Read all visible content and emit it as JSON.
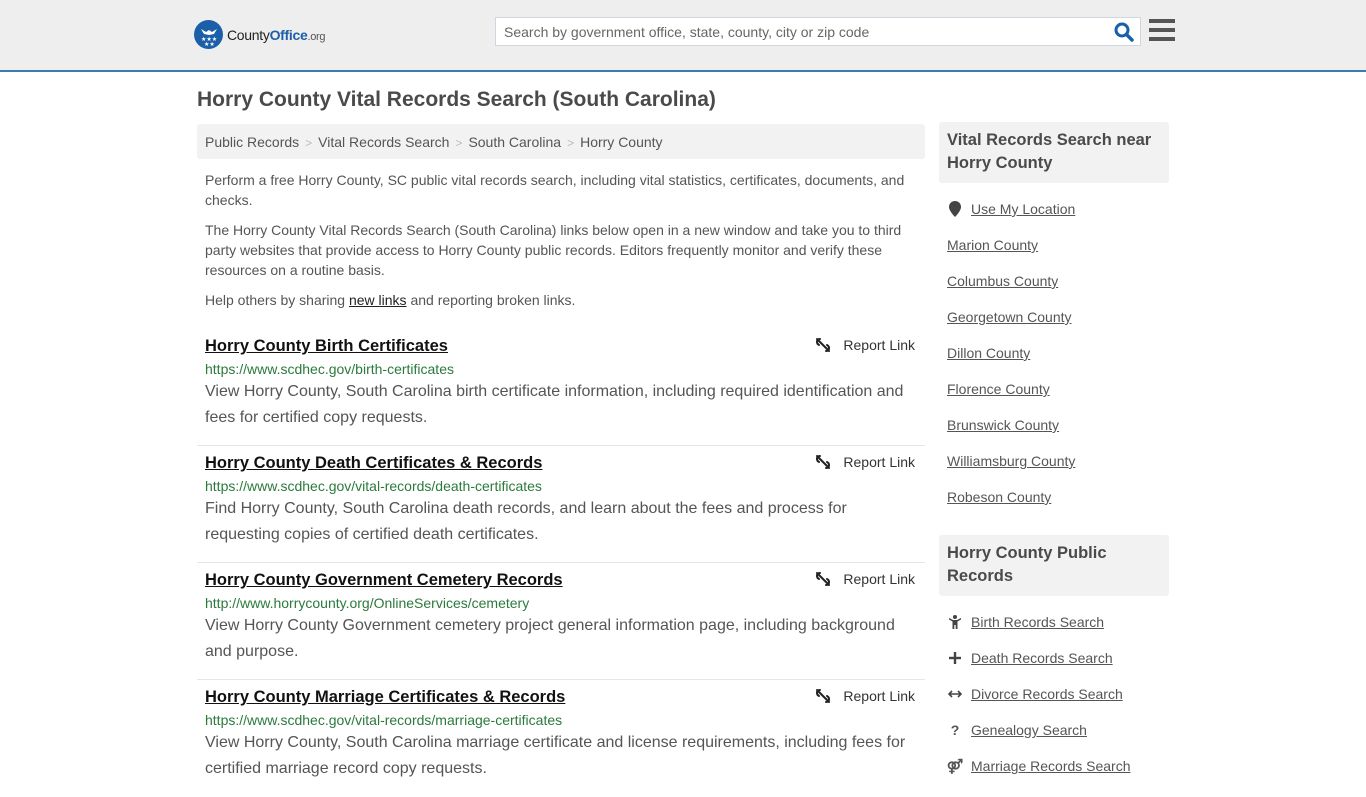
{
  "header": {
    "logo_county": "County",
    "logo_office": "Office",
    "logo_org": ".org",
    "search_placeholder": "Search by government office, state, county, city or zip code",
    "search_value": "",
    "brand_color": "#1b5fa8",
    "accent_border_color": "#3a7cb0"
  },
  "page": {
    "title": "Horry County Vital Records Search (South Carolina)"
  },
  "breadcrumb": [
    "Public Records",
    "Vital Records Search",
    "South Carolina",
    "Horry County"
  ],
  "intro": {
    "p1": "Perform a free Horry County, SC public vital records search, including vital statistics, certificates, documents, and checks.",
    "p2": "The Horry County Vital Records Search (South Carolina) links below open in a new window and take you to third party websites that provide access to Horry County public records. Editors frequently monitor and verify these resources on a routine basis.",
    "p3_before": "Help others by sharing ",
    "p3_link": "new links",
    "p3_after": " and reporting broken links."
  },
  "results": [
    {
      "title": "Horry County Birth Certificates",
      "url": "https://www.scdhec.gov/birth-certificates",
      "description": "View Horry County, South Carolina birth certificate information, including required identification and fees for certified copy requests.",
      "report_label": "Report Link"
    },
    {
      "title": "Horry County Death Certificates & Records",
      "url": "https://www.scdhec.gov/vital-records/death-certificates",
      "description": "Find Horry County, South Carolina death records, and learn about the fees and process for requesting copies of certified death certificates.",
      "report_label": "Report Link"
    },
    {
      "title": "Horry County Government Cemetery Records",
      "url": "http://www.horrycounty.org/OnlineServices/cemetery",
      "description": "View Horry County Government cemetery project general information page, including background and purpose.",
      "report_label": "Report Link"
    },
    {
      "title": "Horry County Marriage Certificates & Records",
      "url": "https://www.scdhec.gov/vital-records/marriage-certificates",
      "description": "View Horry County, South Carolina marriage certificate and license requirements, including fees for certified marriage record copy requests.",
      "report_label": "Report Link"
    }
  ],
  "sidebar": {
    "nearby_title": "Vital Records Search near Horry County",
    "use_location": "Use My Location",
    "nearby": [
      "Marion County",
      "Columbus County",
      "Georgetown County",
      "Dillon County",
      "Florence County",
      "Brunswick County",
      "Williamsburg County",
      "Robeson County"
    ],
    "public_title": "Horry County Public Records",
    "public_records": [
      {
        "label": "Birth Records Search",
        "icon": "child-icon"
      },
      {
        "label": "Death Records Search",
        "icon": "plus-icon"
      },
      {
        "label": "Divorce Records Search",
        "icon": "arrows-horizontal-icon"
      },
      {
        "label": "Genealogy Search",
        "icon": "question-icon"
      },
      {
        "label": "Marriage Records Search",
        "icon": "marriage-symbol-icon"
      }
    ]
  }
}
